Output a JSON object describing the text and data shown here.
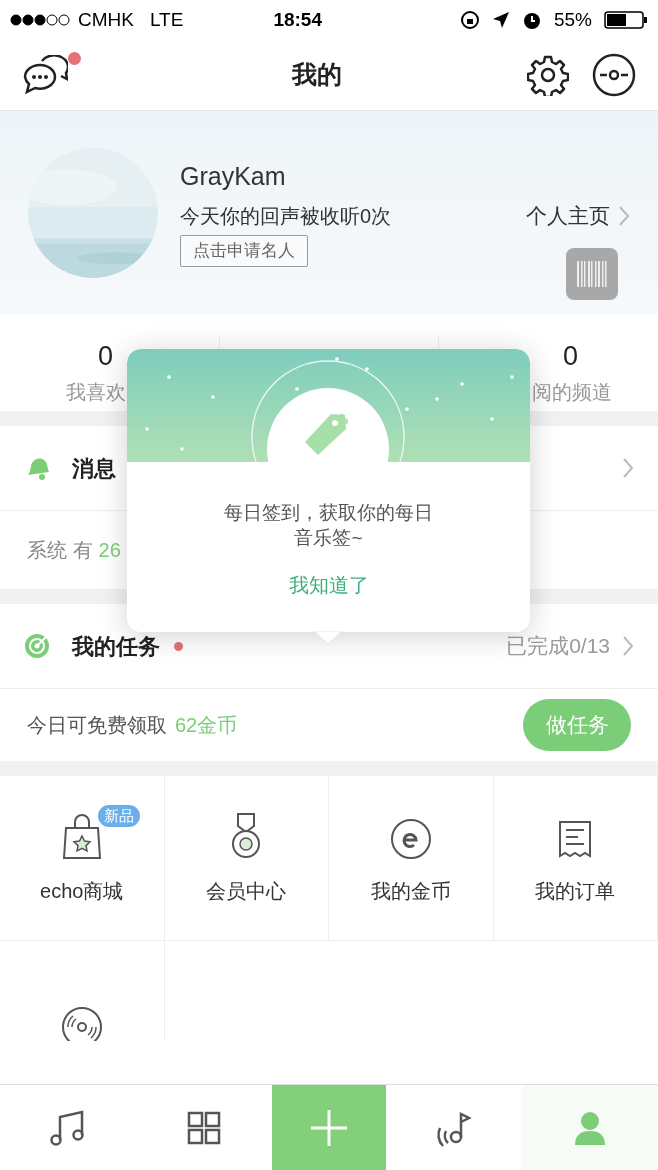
{
  "status_bar": {
    "carrier": "CMHK",
    "network": "LTE",
    "time": "18:54",
    "battery": "55%"
  },
  "header": {
    "title": "我的",
    "unread_messages": true
  },
  "profile": {
    "name": "GrayKam",
    "subtitle": "今天你的回声被收听0次",
    "apply_button": "点击申请名人",
    "homepage_link": "个人主页"
  },
  "stats": {
    "left": {
      "value": "0",
      "label": "我喜欢"
    },
    "right": {
      "value": "0",
      "label": "阅的频道"
    }
  },
  "messages": {
    "title": "消息",
    "system_text": "系统 有",
    "system_count": "26"
  },
  "tasks": {
    "title": "我的任务",
    "unread": true,
    "progress": "已完成0/13",
    "coins_text": "今日可免费领取",
    "coins_amount": "62金币",
    "button": "做任务"
  },
  "grid": [
    {
      "kind": "bag",
      "label": "echo商城",
      "badge": "新品"
    },
    {
      "kind": "medal",
      "label": "会员中心"
    },
    {
      "kind": "coin",
      "label": "我的金币"
    },
    {
      "kind": "receipt",
      "label": "我的订单"
    },
    {
      "kind": "disc"
    }
  ],
  "popup": {
    "lines": [
      "每日签到，获取你的每日",
      "音乐签~"
    ],
    "button": "我知道了"
  },
  "tab_bar": [
    {
      "kind": "music",
      "selected": false
    },
    {
      "kind": "grid",
      "selected": false
    },
    {
      "kind": "add",
      "selected": false
    },
    {
      "kind": "broadcast",
      "selected": false
    },
    {
      "kind": "person",
      "selected": true
    }
  ]
}
